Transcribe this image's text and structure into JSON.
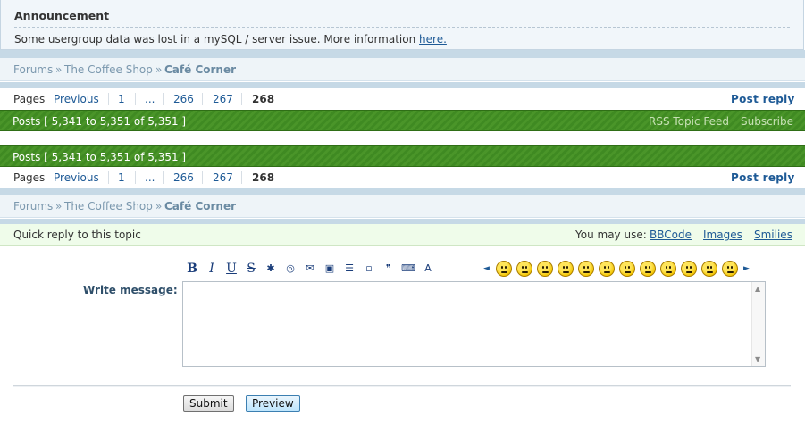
{
  "announcement": {
    "title": "Announcement",
    "text": "Some usergroup data was lost in a mySQL / server issue. More information",
    "link": "here."
  },
  "breadcrumb": {
    "forums": "Forums",
    "sep": "»",
    "coffee_shop": "The Coffee Shop",
    "current": "Café Corner"
  },
  "pagination": {
    "label": "Pages",
    "previous": "Previous",
    "p1": "1",
    "ellipsis": "...",
    "p266": "266",
    "p267": "267",
    "current": "268",
    "post_reply": "Post reply"
  },
  "posts_bar": {
    "text": "Posts [ 5,341 to 5,351 of 5,351 ]",
    "rss": "RSS Topic Feed",
    "subscribe": "Subscribe"
  },
  "quick_reply": {
    "title": "Quick reply to this topic",
    "you_may_use": "You may use:",
    "bbcode": "BBCode",
    "images": "Images",
    "smilies": "Smilies"
  },
  "toolbar": {
    "bold": "B",
    "italic": "I",
    "underline": "U",
    "strike": "S",
    "icons": [
      "sparkle-icon",
      "link-icon",
      "email-icon",
      "image-icon",
      "list-icon",
      "list-item-icon",
      "quote-icon",
      "code-icon",
      "font-icon"
    ]
  },
  "smilies": [
    "smile",
    "neutral",
    "frown",
    "grin",
    "eek",
    "smile",
    "neutral",
    "smile",
    "laugh",
    "angry",
    "neutral",
    "cool"
  ],
  "form": {
    "write_message_label": "Write message:",
    "message_value": "",
    "submit": "Submit",
    "preview": "Preview"
  },
  "colors": {
    "green_bar": "#3f8a22",
    "link": "#1e5a96",
    "smiley": "#f3c400"
  }
}
